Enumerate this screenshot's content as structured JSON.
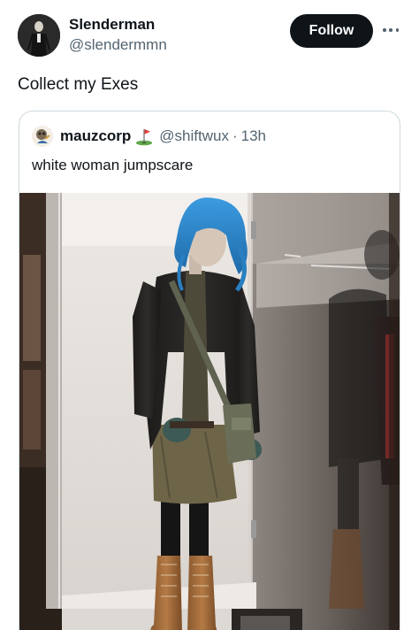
{
  "tweet": {
    "author_name": "Slenderman",
    "author_handle": "@slendermmn",
    "follow_label": "Follow",
    "text": "Collect my Exes"
  },
  "quote": {
    "author_name": "mauzcorp",
    "author_handle": "@shiftwux",
    "separator": "·",
    "time": "13h",
    "text": "white woman jumpscare"
  },
  "icons": {
    "more": "more-icon",
    "badge": "golf-flag-icon"
  },
  "colors": {
    "follow_bg": "#0f1419",
    "secondary_text": "#536471",
    "quote_border": "#cfd9de",
    "wig": "#2e89c9"
  }
}
